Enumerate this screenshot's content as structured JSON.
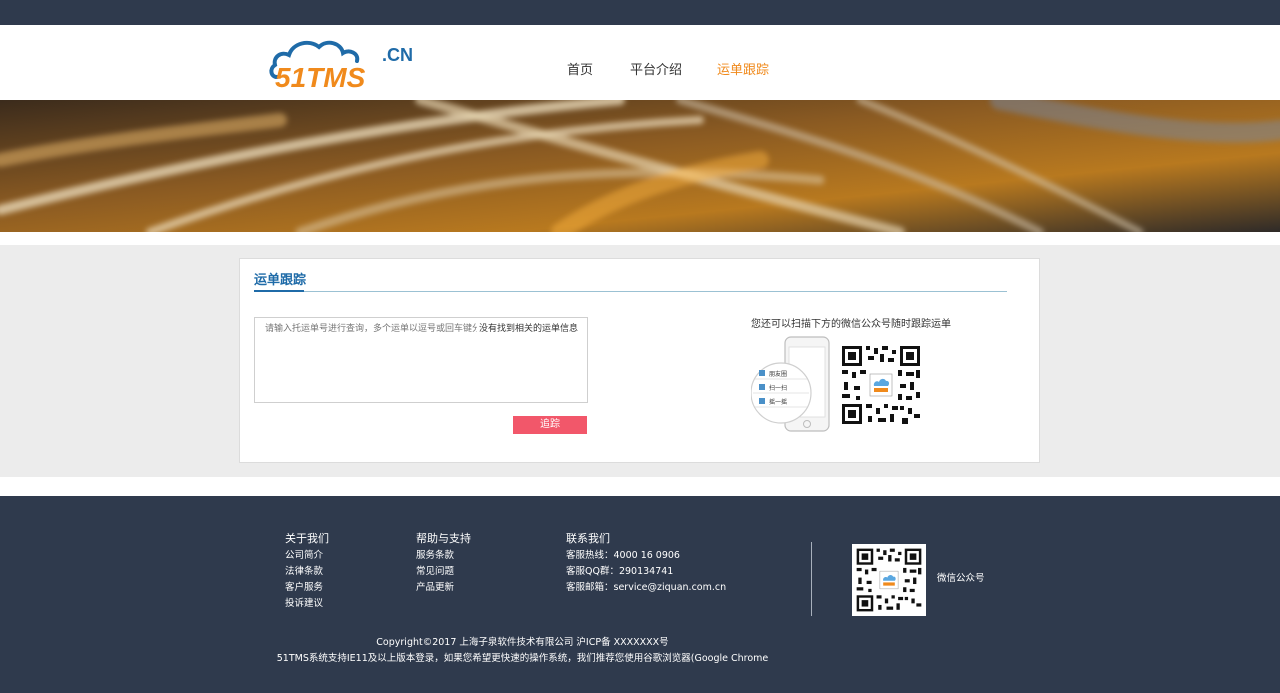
{
  "header": {
    "logo_text": "51TMS",
    "logo_suffix": ".CN",
    "nav": [
      {
        "label": "首页",
        "active": false
      },
      {
        "label": "平台介绍",
        "active": false
      },
      {
        "label": "运单跟踪",
        "active": true
      }
    ]
  },
  "colors": {
    "topbar": "#2f3a4d",
    "accent_orange": "#f08a1c",
    "title_blue": "#1f6ba8",
    "button_red": "#f2576a",
    "footer": "#2f3a4d"
  },
  "tracking": {
    "title": "运单跟踪",
    "input_placeholder": "请输入托运单号进行查询，多个运单以逗号或回车键分割！",
    "not_found_msg": "没有找到相关的运单信息",
    "button_label": "追踪",
    "scan_tip": "您还可以扫描下方的微信公众号随时跟踪运单",
    "phone_menu": [
      "朋友圈",
      "扫一扫",
      "摇一摇"
    ]
  },
  "footer": {
    "about": {
      "title": "关于我们",
      "items": [
        "公司简介",
        "法律条款",
        "客户服务",
        "投诉建议"
      ]
    },
    "help": {
      "title": "帮助与支持",
      "items": [
        "服务条款",
        "常见问题",
        "产品更新"
      ]
    },
    "contact": {
      "title": "联系我们",
      "items": [
        "客服热线：4000 16 0906",
        "客服QQ群：290134741",
        "客服邮箱：service@ziquan.com.cn"
      ]
    },
    "wechat_label": "微信公众号",
    "copyright": "Copyright©2017  上海子泉软件技术有限公司  沪ICP备 XXXXXXX号",
    "browser_tip": "51TMS系统支持IE11及以上版本登录，如果您希望更快速的操作系统，我们推荐您使用谷歌浏览器(Google Chrome"
  }
}
